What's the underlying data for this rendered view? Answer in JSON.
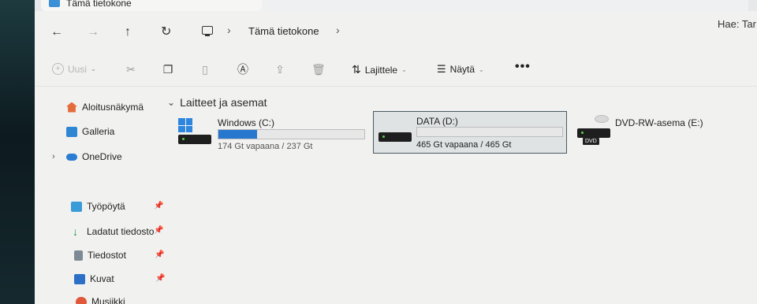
{
  "window": {
    "tab_title": "Tämä tietokone",
    "tab_close": "✕"
  },
  "nav": {
    "back": "←",
    "forward": "→",
    "up": "↑",
    "refresh": "↻",
    "separator": "›",
    "breadcrumb": "Tämä tietokone",
    "search_placeholder": "Hae: Tar"
  },
  "toolbar": {
    "new_label": "Uusi",
    "sort_label": "Lajittele",
    "view_label": "Näytä",
    "more_label": "•••",
    "icons": [
      "cut-icon",
      "copy-icon",
      "paste-icon",
      "rename-icon",
      "share-icon",
      "delete-icon"
    ]
  },
  "sidebar": {
    "home": "Aloitusnäkymä",
    "gallery": "Galleria",
    "onedrive": "OneDrive",
    "quick": [
      {
        "label": "Työpöytä"
      },
      {
        "label": "Ladatut tiedosto"
      },
      {
        "label": "Tiedostot"
      },
      {
        "label": "Kuvat"
      },
      {
        "label": "Musiikki"
      }
    ]
  },
  "content": {
    "section_title": "Laitteet ja asemat",
    "drives": [
      {
        "name": "Windows (C:)",
        "free": "174 Gt vapaana / 237 Gt",
        "used_fraction": 0.266,
        "selected": false
      },
      {
        "name": "DATA (D:)",
        "free": "465 Gt vapaana / 465 Gt",
        "used_fraction": 0.0,
        "selected": true
      },
      {
        "name": "DVD-RW-asema (E:)",
        "badge": "DVD"
      }
    ]
  },
  "colors": {
    "accent": "#2877cf",
    "selection_border": "#4b5a60"
  }
}
